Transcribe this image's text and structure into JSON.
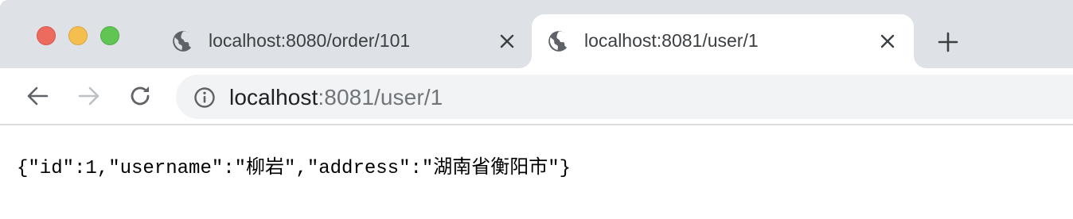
{
  "window": {
    "traffic_lights": [
      "close",
      "minimize",
      "zoom"
    ]
  },
  "tabs": [
    {
      "title": "localhost:8080/order/101",
      "active": false,
      "icon": "globe-icon"
    },
    {
      "title": "localhost:8081/user/1",
      "active": true,
      "icon": "globe-icon"
    }
  ],
  "toolbar": {
    "address_host": "localhost",
    "address_rest": ":8081/user/1"
  },
  "page": {
    "body_text": "{\"id\":1,\"username\":\"柳岩\",\"address\":\"湖南省衡阳市\"}"
  },
  "colors": {
    "titlebar_bg": "#dee1e6",
    "omnibox_bg": "#f1f3f4",
    "close_red": "#ed6a5e",
    "minimize_yellow": "#f5bf4f",
    "zoom_green": "#61c554"
  }
}
